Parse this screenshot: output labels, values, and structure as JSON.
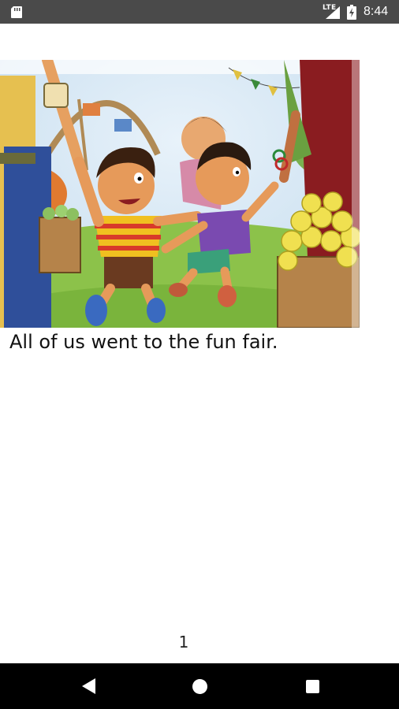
{
  "status_bar": {
    "network": "LTE",
    "time": "8:44",
    "icons": [
      "sd-card-icon",
      "signal-icon",
      "battery-charging-icon"
    ]
  },
  "story": {
    "illustration": "children-at-fun-fair",
    "caption": "All of us went to the fun fair.",
    "page_number": "1"
  },
  "nav_bar": {
    "buttons": [
      "back",
      "home",
      "recents"
    ]
  },
  "colors": {
    "status_bar": "#4a4a4a",
    "nav_bar": "#000000",
    "background": "#ffffff"
  }
}
